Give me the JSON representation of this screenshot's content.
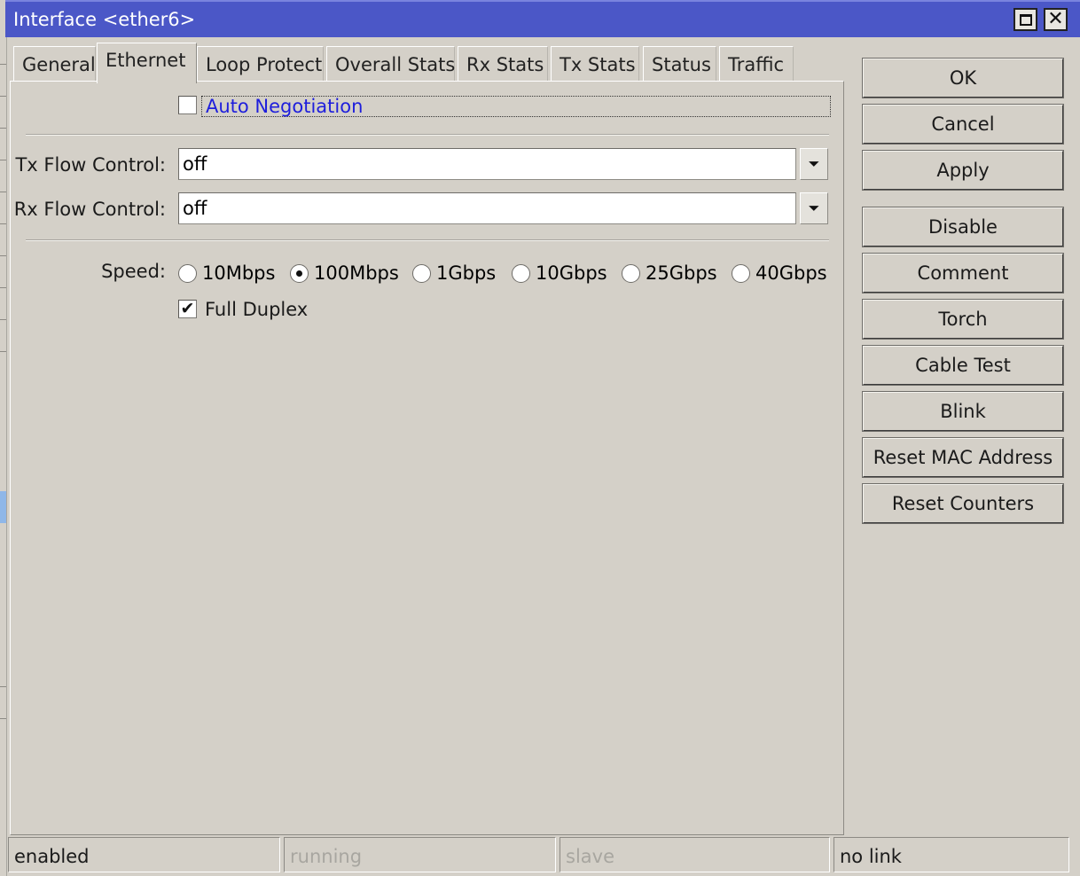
{
  "window": {
    "title": "Interface <ether6>"
  },
  "tabs": [
    {
      "label": "General"
    },
    {
      "label": "Ethernet"
    },
    {
      "label": "Loop Protect"
    },
    {
      "label": "Overall Stats"
    },
    {
      "label": "Rx Stats"
    },
    {
      "label": "Tx Stats"
    },
    {
      "label": "Status"
    },
    {
      "label": "Traffic"
    }
  ],
  "active_tab": "Ethernet",
  "form": {
    "auto_negotiation": {
      "label": "Auto Negotiation",
      "checked": false
    },
    "tx_flow_control": {
      "label": "Tx Flow Control:",
      "value": "off"
    },
    "rx_flow_control": {
      "label": "Rx Flow Control:",
      "value": "off"
    },
    "speed": {
      "label": "Speed:",
      "options": [
        "10Mbps",
        "100Mbps",
        "1Gbps",
        "10Gbps",
        "25Gbps",
        "40Gbps"
      ],
      "selected": "100Mbps"
    },
    "full_duplex": {
      "label": "Full Duplex",
      "checked": true
    }
  },
  "buttons": {
    "ok": "OK",
    "cancel": "Cancel",
    "apply": "Apply",
    "disable": "Disable",
    "comment": "Comment",
    "torch": "Torch",
    "cable_test": "Cable Test",
    "blink": "Blink",
    "reset_mac": "Reset MAC Address",
    "reset_counters": "Reset Counters"
  },
  "status": {
    "enabled": "enabled",
    "running": "running",
    "slave": "slave",
    "link": "no link"
  },
  "colors": {
    "titlebar": "#4b57c7",
    "window_bg": "#d4d0c8",
    "link_text": "#1e1edc"
  }
}
